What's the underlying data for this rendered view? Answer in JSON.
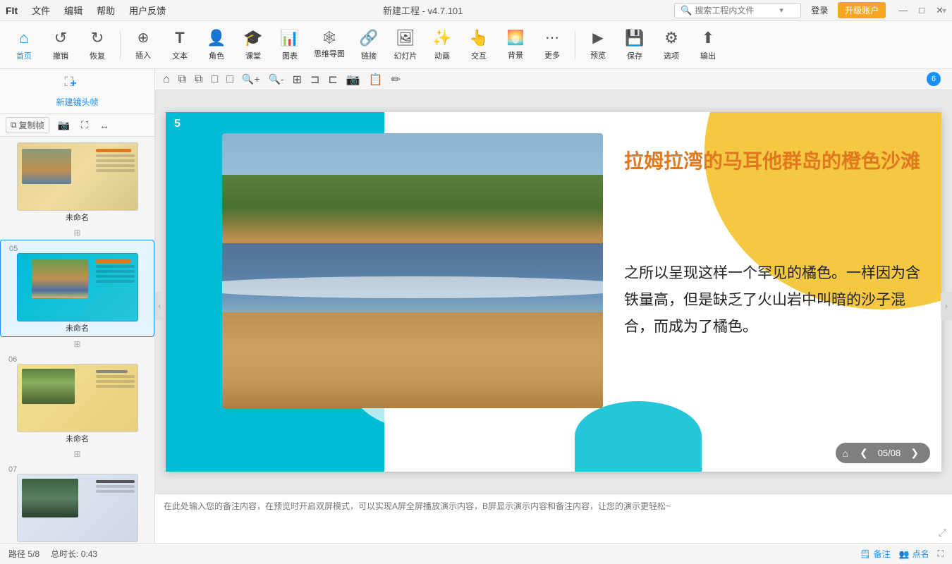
{
  "titlebar": {
    "logo": "FIt",
    "menus": [
      "文件",
      "编辑",
      "帮助",
      "用户反馈"
    ],
    "title": "新建工程 - v4.7.101",
    "search_placeholder": "搜索工程内文件",
    "login_label": "登录",
    "upgrade_label": "升级账户",
    "win_min": "—",
    "win_restore": "□",
    "win_close": "✕"
  },
  "toolbar": {
    "items": [
      {
        "id": "home",
        "icon": "⌂",
        "label": "首页"
      },
      {
        "id": "undo",
        "icon": "↺",
        "label": "撤销"
      },
      {
        "id": "redo",
        "icon": "↻",
        "label": "恢复"
      },
      {
        "id": "insert",
        "icon": "⊕",
        "label": "插入"
      },
      {
        "id": "text",
        "icon": "T",
        "label": "文本"
      },
      {
        "id": "role",
        "icon": "👤",
        "label": "角色"
      },
      {
        "id": "classroom",
        "icon": "🎓",
        "label": "课堂"
      },
      {
        "id": "chart",
        "icon": "📊",
        "label": "图表"
      },
      {
        "id": "mindmap",
        "icon": "🕸",
        "label": "思维导图"
      },
      {
        "id": "link",
        "icon": "🔗",
        "label": "链接"
      },
      {
        "id": "slideshow",
        "icon": "🖼",
        "label": "幻灯片"
      },
      {
        "id": "animate",
        "icon": "✨",
        "label": "动画"
      },
      {
        "id": "interact",
        "icon": "👆",
        "label": "交互"
      },
      {
        "id": "bg",
        "icon": "🖼",
        "label": "背景"
      },
      {
        "id": "more",
        "icon": "⋯",
        "label": "更多"
      },
      {
        "id": "preview",
        "icon": "▶",
        "label": "预览"
      },
      {
        "id": "save",
        "icon": "💾",
        "label": "保存"
      },
      {
        "id": "options",
        "icon": "⚙",
        "label": "选项"
      },
      {
        "id": "export",
        "icon": "⬆",
        "label": "输出"
      }
    ]
  },
  "sidebar": {
    "new_frame_label": "新建镜头帧",
    "tools": [
      "复制帧",
      "📷",
      "⛶",
      "↔"
    ],
    "slides": [
      {
        "num": "",
        "label": "未命名",
        "type": "thumb-04"
      },
      {
        "num": "05",
        "label": "未命名",
        "type": "thumb-05",
        "active": true
      },
      {
        "num": "06",
        "label": "未命名",
        "type": "thumb-06"
      },
      {
        "num": "07",
        "label": "...",
        "type": "thumb-07"
      }
    ]
  },
  "canvas_toolbar": {
    "tools": [
      "⌂",
      "⧉",
      "⧉",
      "□",
      "□",
      "🔍+",
      "🔍-",
      "⊞",
      "⊐",
      "⊏",
      "📷",
      "📋",
      "✏"
    ]
  },
  "slide": {
    "num": "5",
    "title": "拉姆拉湾的马耳他群岛的橙色沙滩",
    "body": "之所以呈现这样一个罕见的橘色。一样因为含铁量高，但是缺乏了火山岩中叫暗的沙子混合，而成为了橘色。",
    "nav": {
      "current": "05",
      "total": "08"
    }
  },
  "notes": {
    "placeholder": "在此处输入您的备注内容，在预览时开启双屏模式，可以实现A屏全屏播放演示内容，B屏显示演示内容和备注内容，让您的演示更轻松~"
  },
  "statusbar": {
    "path": "路径 5/8",
    "duration": "总时长: 0:43",
    "comment_label": "备注",
    "points_label": "点名"
  },
  "right_panel_badge": "6"
}
